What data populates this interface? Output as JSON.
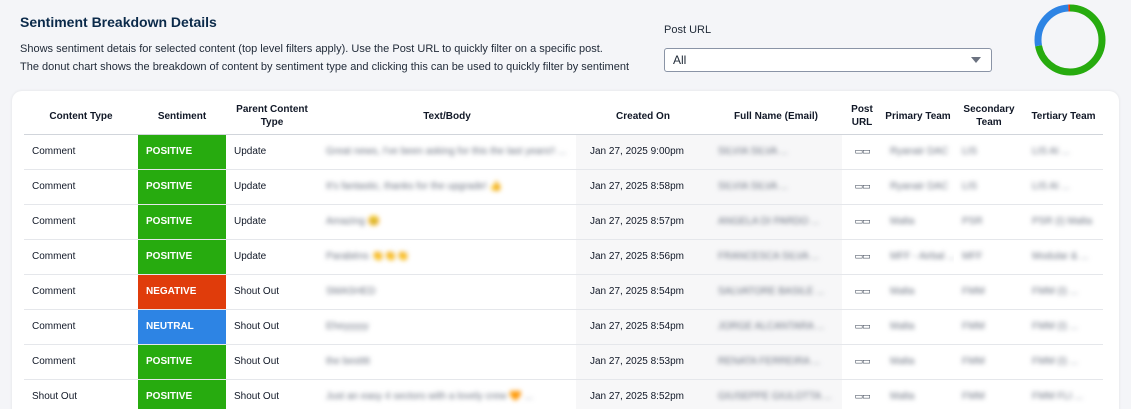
{
  "header": {
    "title": "Sentiment Breakdown Details",
    "desc1": "Shows sentiment detais for selected content (top level filters apply). Use the Post URL to quickly filter on a specific post.",
    "desc2": "The donut chart shows the breakdown of content by sentiment type and clicking this can be used to quickly filter by sentiment"
  },
  "filter": {
    "label": "Post URL",
    "value": "All"
  },
  "colors": {
    "positive": "#27ab0f",
    "negative": "#e03c0b",
    "neutral": "#2d84e4"
  },
  "donut": {
    "positive": 0.72,
    "neutral": 0.27,
    "negative": 0.01
  },
  "table": {
    "columns": [
      "Content Type",
      "Sentiment",
      "Parent Content Type",
      "Text/Body",
      "Created On",
      "Full Name (Email)",
      "Post URL",
      "Primary Team",
      "Secondary Team",
      "Tertiary Team"
    ],
    "rows": [
      {
        "type": "Comment",
        "sentiment": "POSITIVE",
        "parent": "Update",
        "text": "Great news, I've been asking for this the last years!! ...",
        "created": "Jan 27, 2025 9:00pm",
        "name": "SILVIA SILVA ...",
        "primary": "Ryanair DAC",
        "secondary": "LIS",
        "tertiary": "LIS AI ..."
      },
      {
        "type": "Comment",
        "sentiment": "POSITIVE",
        "parent": "Update",
        "text": "It's fantastic, thanks for the upgrade! 👍",
        "created": "Jan 27, 2025 8:58pm",
        "name": "SILVIA SILVA ...",
        "primary": "Ryanair DAC",
        "secondary": "LIS",
        "tertiary": "LIS AI ..."
      },
      {
        "type": "Comment",
        "sentiment": "POSITIVE",
        "parent": "Update",
        "text": "Amazing 😊",
        "created": "Jan 27, 2025 8:57pm",
        "name": "ANGELA DI PARDO ...",
        "primary": "Malta",
        "secondary": "PSR",
        "tertiary": "PSR (I) Malta"
      },
      {
        "type": "Comment",
        "sentiment": "POSITIVE",
        "parent": "Update",
        "text": "Parabéns 👏👏👏",
        "created": "Jan 27, 2025 8:56pm",
        "name": "FRANCESCA SILVA ...",
        "primary": "MFF - Airbal ...",
        "secondary": "MFF",
        "tertiary": "Modular & ..."
      },
      {
        "type": "Comment",
        "sentiment": "NEGATIVE",
        "parent": "Shout Out",
        "text": "SMASHED",
        "created": "Jan 27, 2025 8:54pm",
        "name": "SALVATORE BASILE ...",
        "primary": "Malta",
        "secondary": "FMM",
        "tertiary": "FMM (I) ..."
      },
      {
        "type": "Comment",
        "sentiment": "NEUTRAL",
        "parent": "Shout Out",
        "text": "Eheyyyyy",
        "created": "Jan 27, 2025 8:54pm",
        "name": "JORGE ALCANTARA ...",
        "primary": "Malta",
        "secondary": "FMM",
        "tertiary": "FMM (I) ..."
      },
      {
        "type": "Comment",
        "sentiment": "POSITIVE",
        "parent": "Shout Out",
        "text": "the bestttt",
        "created": "Jan 27, 2025 8:53pm",
        "name": "RENATA FERREIRA ...",
        "primary": "Malta",
        "secondary": "FMM",
        "tertiary": "FMM (I) ..."
      },
      {
        "type": "Shout Out",
        "sentiment": "POSITIVE",
        "parent": "Shout Out",
        "text": "Just an easy 4 sectors with a lovely crew 🧡 ...",
        "created": "Jan 27, 2025 8:52pm",
        "name": "GIUSEPPE GIULOTTA ...",
        "primary": "Malta",
        "secondary": "FMM",
        "tertiary": "FMM FLI ..."
      }
    ]
  }
}
